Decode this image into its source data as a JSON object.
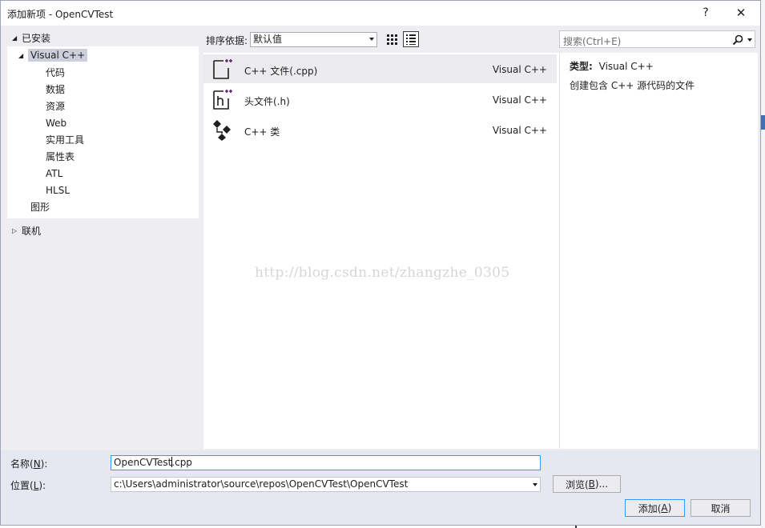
{
  "window": {
    "title": "添加新项 - OpenCVTest",
    "help_label": "?",
    "close_label": "✕"
  },
  "left_panel": {
    "installed_label": "已安装",
    "tree_root": "Visual C++",
    "tree_children": [
      "代码",
      "数据",
      "资源",
      "Web",
      "实用工具",
      "属性表",
      "ATL",
      "HLSL"
    ],
    "tree_graphics": "图形",
    "online_label": "联机"
  },
  "toolbar": {
    "sort_label": "排序依据:",
    "sort_value": "默认值"
  },
  "search": {
    "placeholder": "搜索(Ctrl+E)"
  },
  "templates": [
    {
      "name": "C++ 文件(.cpp)",
      "lang": "Visual C++",
      "icon": "cpp-file-icon"
    },
    {
      "name": "头文件(.h)",
      "lang": "Visual C++",
      "icon": "header-file-icon"
    },
    {
      "name": "C++ 类",
      "lang": "Visual C++",
      "icon": "cpp-class-icon"
    }
  ],
  "watermark": "http://blog.csdn.net/zhangzhe_0305",
  "details": {
    "type_label": "类型:",
    "type_value": "Visual C++",
    "description": "创建包含 C++ 源代码的文件"
  },
  "form": {
    "name_label_pre": "名称(",
    "name_label_key": "N",
    "name_label_post": "):",
    "name_value_a": "OpenCVTest",
    "name_value_b": ".cpp",
    "location_label_pre": "位置(",
    "location_label_key": "L",
    "location_label_post": "):",
    "location_value": "c:\\Users\\administrator\\source\\repos\\OpenCVTest\\OpenCVTest",
    "browse_pre": "浏览(",
    "browse_key": "B",
    "browse_post": ")...",
    "add_pre": "添加(",
    "add_key": "A",
    "add_post": ")",
    "cancel_label": "取消"
  },
  "colors": {
    "accent": "#3399ff",
    "selection": "#cccedb",
    "icon_plus": "#68217a"
  }
}
